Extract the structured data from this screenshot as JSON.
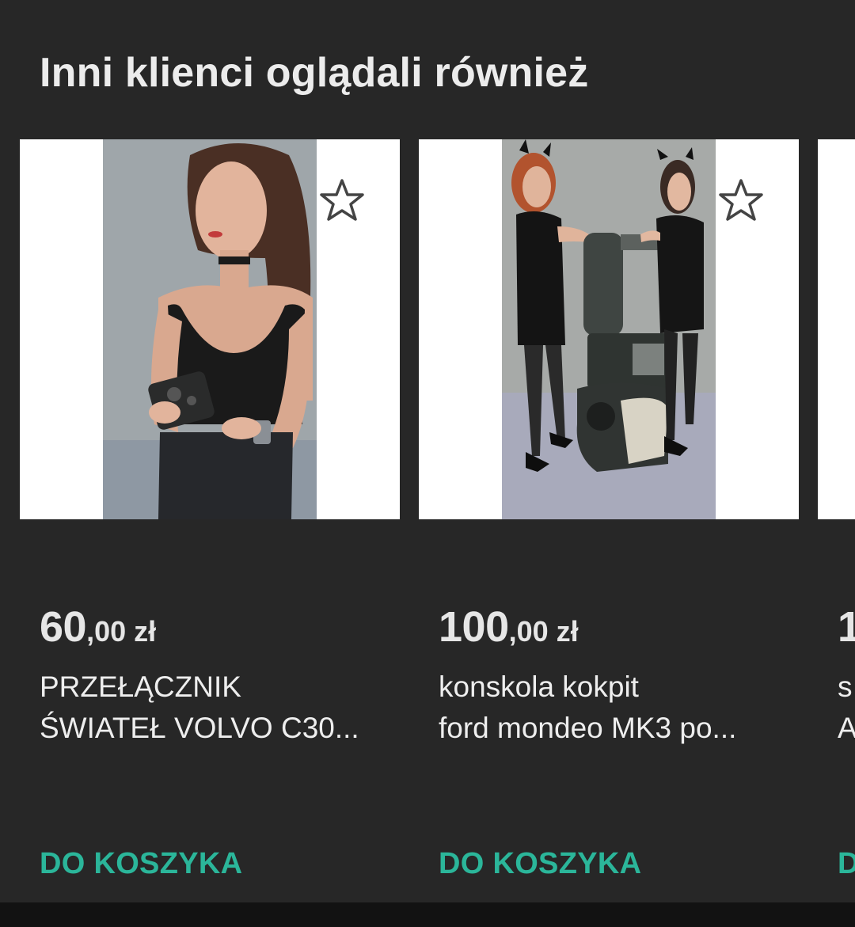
{
  "section": {
    "title": "Inni klienci oglądali również"
  },
  "products": [
    {
      "price_main": "60",
      "price_rest": ",00 zł",
      "title_line1": "PRZEŁĄCZNIK",
      "title_line2": "ŚWIATEŁ VOLVO C30...",
      "cart_label": "DO KOSZYKA",
      "favorite_icon": "star-outline-icon",
      "image": "woman-holding-light-switch-photo"
    },
    {
      "price_main": "100",
      "price_rest": ",00 zł",
      "title_line1": "konskola kokpit",
      "title_line2": "ford mondeo MK3 po...",
      "cart_label": "DO KOSZYKA",
      "favorite_icon": "star-outline-icon",
      "image": "two-women-with-dashboard-photo"
    },
    {
      "price_main": "1",
      "price_rest": "",
      "title_line1": "s",
      "title_line2": "A",
      "cart_label": "D",
      "favorite_icon": "star-outline-icon",
      "image": "product-photo"
    }
  ],
  "colors": {
    "background": "#272727",
    "accent": "#2bb69a",
    "text": "#e8e8e8"
  }
}
